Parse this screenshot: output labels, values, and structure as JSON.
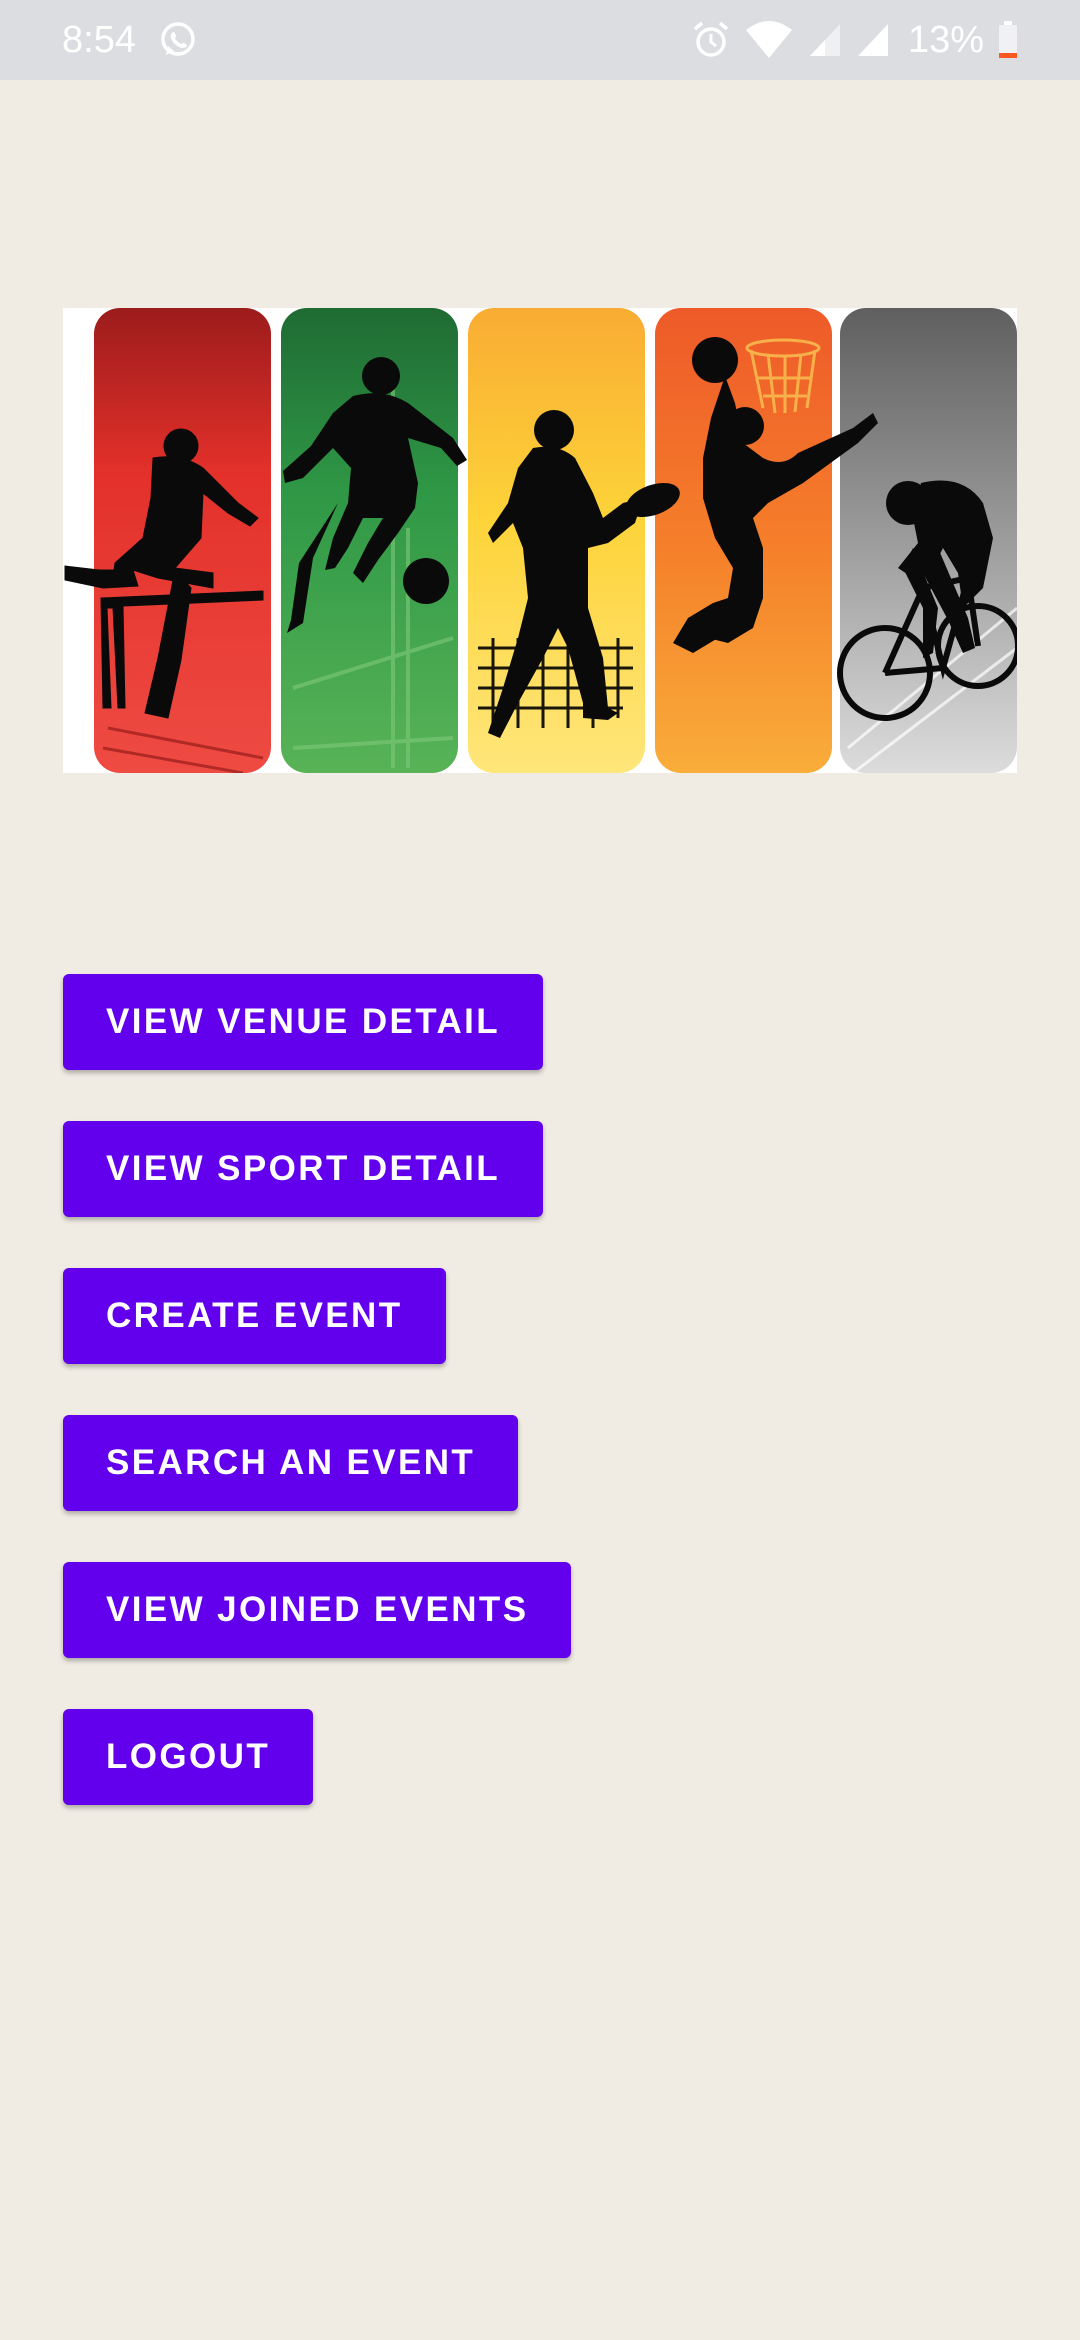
{
  "status_bar": {
    "time": "8:54",
    "battery": "13%",
    "icons": [
      "whatsapp-icon",
      "alarm-icon",
      "wifi-icon",
      "signal-icon",
      "signal-icon",
      "battery-icon"
    ],
    "background": "#dcdde1"
  },
  "banner": {
    "image": "sports-silhouettes-banner",
    "panels": [
      "hurdler",
      "football-kicker",
      "rugby-player",
      "basketball-dunk",
      "cyclist"
    ],
    "panel_colors": [
      "#e53935",
      "#2e9a46",
      "#fdd835",
      "#f57c1f",
      "#9e9e9e"
    ]
  },
  "menu": {
    "buttons": [
      {
        "label": "VIEW VENUE DETAIL"
      },
      {
        "label": "VIEW SPORT DETAIL"
      },
      {
        "label": "CREATE EVENT"
      },
      {
        "label": "SEARCH AN EVENT"
      },
      {
        "label": "VIEW JOINED EVENTS"
      },
      {
        "label": "LOGOUT"
      }
    ]
  },
  "colors": {
    "button": "#6200ee",
    "background": "#f0ece4"
  }
}
